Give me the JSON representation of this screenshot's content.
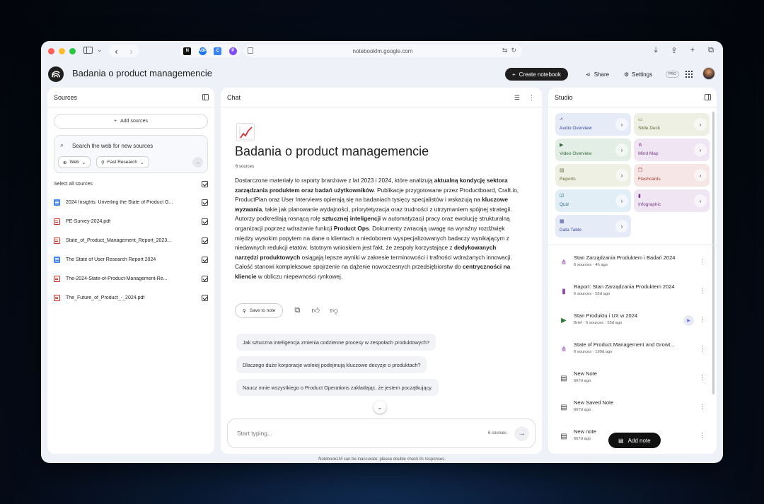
{
  "browser": {
    "url": "notebooklm.google.com",
    "extensions": [
      "N",
      "ABP",
      "C",
      "P"
    ]
  },
  "app": {
    "title": "Badania o product managemencie",
    "create_label": "Create notebook",
    "share_label": "Share",
    "settings_label": "Settings",
    "pro_label": "PRO"
  },
  "sources": {
    "header": "Sources",
    "add_label": "Add sources",
    "search_placeholder": "Search the web for new sources",
    "chip_web": "Web",
    "chip_fast": "Fast Research",
    "select_all": "Select all sources",
    "items": [
      {
        "name": "2024 Insights: Unveiling the State of Product G...",
        "type": "doc"
      },
      {
        "name": "PE-Survey-2024.pdf",
        "type": "pdf"
      },
      {
        "name": "State_of_Product_Management_Report_2023...",
        "type": "pdf"
      },
      {
        "name": "The State of User Research Report 2024",
        "type": "doc"
      },
      {
        "name": "The-2024-State-of-Product-Management-Re...",
        "type": "pdf"
      },
      {
        "name": "The_Future_of_Product_-_2024.pdf",
        "type": "pdf"
      }
    ]
  },
  "chat": {
    "header": "Chat",
    "notebook_title": "Badania o product managemencie",
    "source_count": "6 sources",
    "summary": [
      {
        "t": "Dostarczone materiały to raporty branżowe z lat 2023 i 2024, które analizują ",
        "b": false
      },
      {
        "t": "aktualną kondycję sektora zarządzania produktem oraz badań użytkowników",
        "b": true
      },
      {
        "t": ". Publikacje przygotowane przez Productboard, Craft.io, ProductPlan oraz User Interviews opierają się na badaniach tysięcy specjalistów i wskazują na ",
        "b": false
      },
      {
        "t": "kluczowe wyzwania",
        "b": true
      },
      {
        "t": ", takie jak planowanie wydajności, priorytetyzacja oraz trudności z utrzymaniem spójnej strategii. Autorzy podkreślają rosnącą rolę ",
        "b": false
      },
      {
        "t": "sztucznej inteligencji",
        "b": true
      },
      {
        "t": " w automatyzacji pracy oraz ewolucję strukturalną organizacji poprzez wdrażanie funkcji ",
        "b": false
      },
      {
        "t": "Product Ops",
        "b": true
      },
      {
        "t": ". Dokumenty zwracają uwagę na wyraźny rozdźwięk między wysokim popytem na dane o klientach a niedoborem wyspecjalizowanych badaczy wynikającym z niedawnych redukcji etatów. Istotnym wnioskiem jest fakt, że zespoły korzystające z ",
        "b": false
      },
      {
        "t": "dedykowanych narzędzi produktowych",
        "b": true
      },
      {
        "t": " osiągają lepsze wyniki w zakresie terminowości i trafności wdrażanych innowacji. Całość stanowi kompleksowe spojrzenie na dążenie nowoczesnych przedsiębiorstw do ",
        "b": false
      },
      {
        "t": "centryczności na kliencie",
        "b": true
      },
      {
        "t": " w obliczu niepewności rynkowej.",
        "b": false
      }
    ],
    "save_to_note": "Save to note",
    "suggestions": [
      "Jak sztuczna inteligencja zmienia codzienne procesy w zespołach produktowych?",
      "Dlaczego duże korporacje wolniej podejmują kluczowe decyzje o produktach?",
      "Naucz mnie wszystkiego o Product Operations zakładając, że jestem początkujący."
    ],
    "input_placeholder": "Start typing...",
    "input_source_count": "6 sources"
  },
  "studio": {
    "header": "Studio",
    "tiles": [
      {
        "label": "Audio Overview",
        "icon": "waveform-icon",
        "bg": "#e6ebf8",
        "fg": "#3b4a9c"
      },
      {
        "label": "Slide Deck",
        "icon": "slides-icon",
        "bg": "#eef0e4",
        "fg": "#6b6a3a"
      },
      {
        "label": "Video Overview",
        "icon": "video-icon",
        "bg": "#e3efe6",
        "fg": "#2e6b3c"
      },
      {
        "label": "Mind Map",
        "icon": "mindmap-icon",
        "bg": "#f0e6f3",
        "fg": "#7a3a8a"
      },
      {
        "label": "Reports",
        "icon": "report-icon",
        "bg": "#eef0e4",
        "fg": "#6b6a3a"
      },
      {
        "label": "Flashcards",
        "icon": "cards-icon",
        "bg": "#f6e7e6",
        "fg": "#9a3b33"
      },
      {
        "label": "Quiz",
        "icon": "quiz-icon",
        "bg": "#e1eef6",
        "fg": "#2f6a8c"
      },
      {
        "label": "Infographic",
        "icon": "infographic-icon",
        "bg": "#f0e6f3",
        "fg": "#7a3a8a"
      },
      {
        "label": "Data Table",
        "icon": "table-icon",
        "bg": "#e6ebf8",
        "fg": "#3b4a9c"
      }
    ],
    "notes": [
      {
        "title": "Stan Zarządzania Produktem i Badań 2024",
        "meta": "6 sources · 4h ago",
        "icon": "mindmap-icon",
        "color": "#8e44ad",
        "play": false
      },
      {
        "title": "Raport: Stan Zarządzania Produktem 2024",
        "meta": "6 sources · 55d ago",
        "icon": "infographic-icon",
        "color": "#8e44ad",
        "play": false
      },
      {
        "title": "Stan Produktu i UX w 2024",
        "meta": "Brief · 6 sources · 55d ago",
        "icon": "video-icon",
        "color": "#2e7d32",
        "play": true
      },
      {
        "title": "State of Product Management and Growt...",
        "meta": "6 sources · 199d ago",
        "icon": "mindmap-icon",
        "color": "#8e44ad",
        "play": false
      },
      {
        "title": "New Note",
        "meta": "667d ago",
        "icon": "note-icon",
        "color": "#333333",
        "play": false
      },
      {
        "title": "New Saved Note",
        "meta": "667d ago",
        "icon": "note-icon",
        "color": "#333333",
        "play": false
      },
      {
        "title": "New note",
        "meta": "667d ago",
        "icon": "note-icon",
        "color": "#333333",
        "play": false
      }
    ],
    "add_note": "Add note"
  },
  "footer": "NotebookLM can be inaccurate; please double check its responses."
}
